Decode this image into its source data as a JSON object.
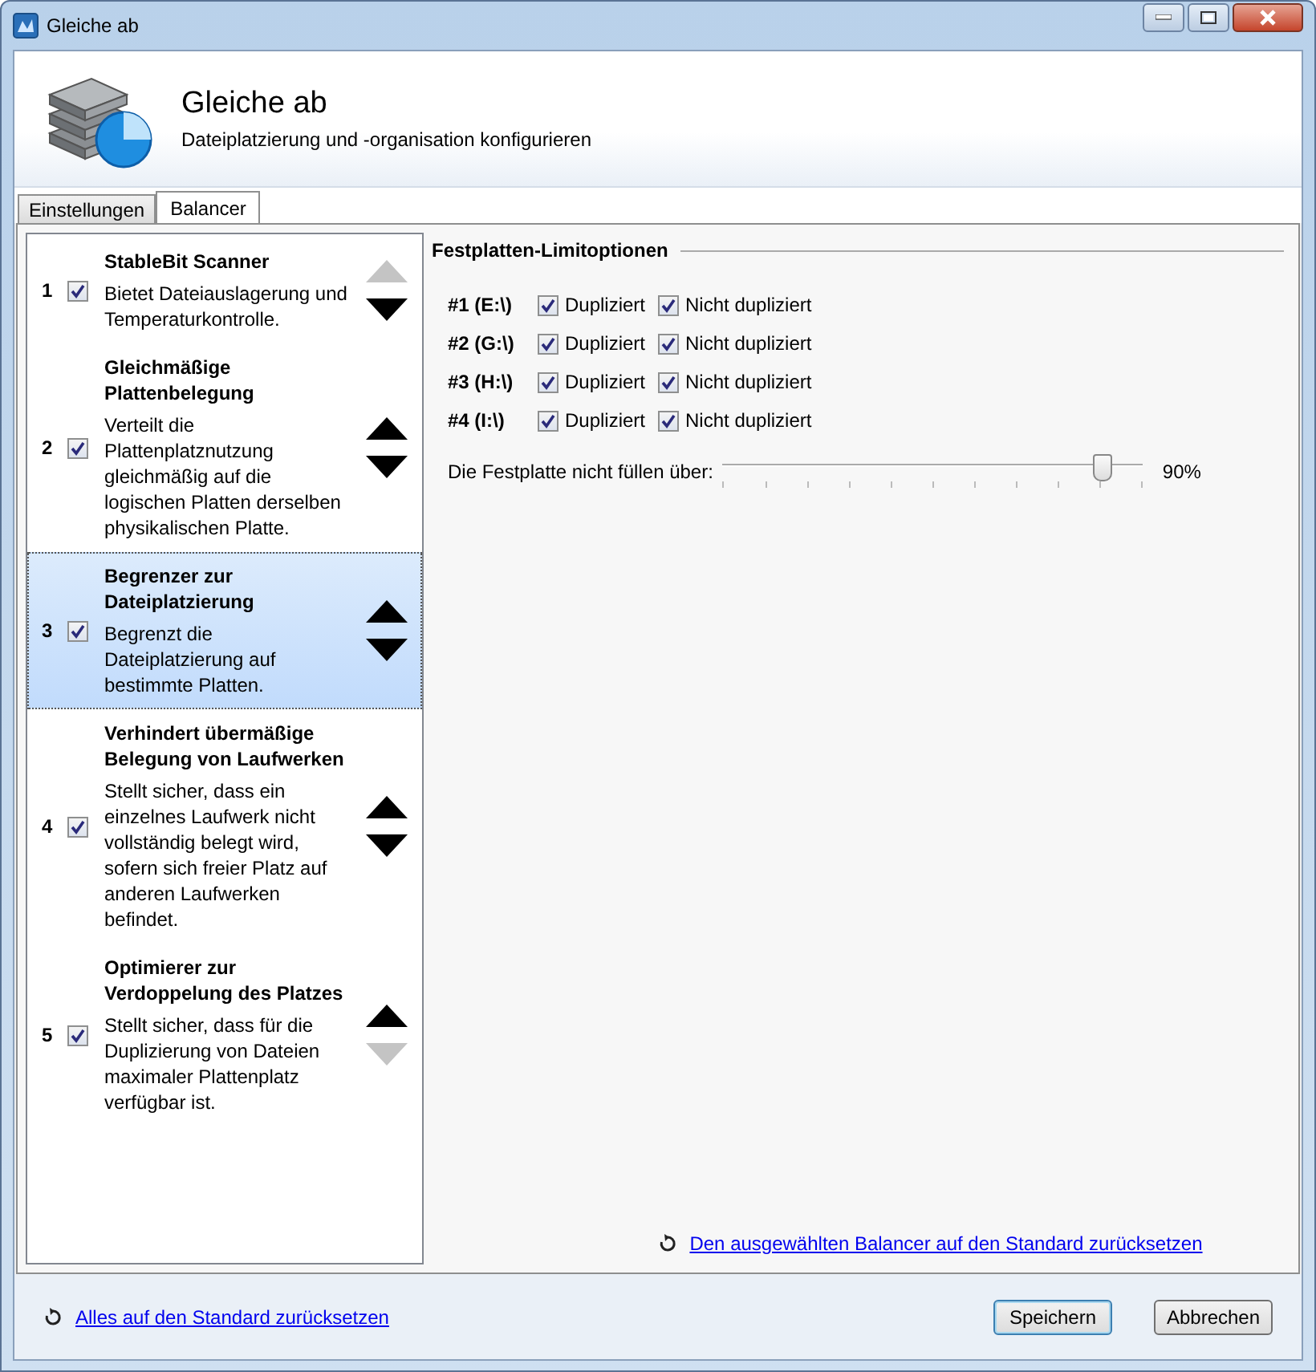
{
  "window": {
    "title": "Gleiche ab"
  },
  "header": {
    "title": "Gleiche ab",
    "subtitle": "Dateiplatzierung und -organisation konfigurieren"
  },
  "tabs": [
    {
      "label": "Einstellungen",
      "selected": false
    },
    {
      "label": "Balancer",
      "selected": true
    }
  ],
  "balancers": [
    {
      "number": "1",
      "checked": true,
      "title": "StableBit Scanner",
      "description": "Bietet Dateiauslagerung und Temperaturkontrolle.",
      "selected": false,
      "up_enabled": false,
      "down_enabled": true
    },
    {
      "number": "2",
      "checked": true,
      "title": "Gleichmäßige Plattenbelegung",
      "description": "Verteilt die Plattenplatznutzung gleichmäßig auf die logischen Platten derselben physikalischen Platte.",
      "selected": false,
      "up_enabled": true,
      "down_enabled": true
    },
    {
      "number": "3",
      "checked": true,
      "title": "Begrenzer zur Dateiplatzierung",
      "description": "Begrenzt die Dateiplatzierung auf bestimmte Platten.",
      "selected": true,
      "up_enabled": true,
      "down_enabled": true
    },
    {
      "number": "4",
      "checked": true,
      "title": "Verhindert übermäßige Belegung von Laufwerken",
      "description": "Stellt sicher, dass ein einzelnes Laufwerk nicht vollständig belegt wird, sofern sich freier Platz auf anderen Laufwerken befindet.",
      "selected": false,
      "up_enabled": true,
      "down_enabled": true
    },
    {
      "number": "5",
      "checked": true,
      "title": "Optimierer zur Verdoppelung des Platzes",
      "description": "Stellt sicher, dass für die Duplizierung von Dateien maximaler Plattenplatz verfügbar ist.",
      "selected": false,
      "up_enabled": true,
      "down_enabled": false
    }
  ],
  "options": {
    "title": "Festplatten-Limitoptionen",
    "drives": [
      {
        "label": "#1 (E:\\)",
        "duplicated": {
          "label": "Dupliziert",
          "checked": true
        },
        "unduplicated": {
          "label": "Nicht dupliziert",
          "checked": true
        }
      },
      {
        "label": "#2 (G:\\)",
        "duplicated": {
          "label": "Dupliziert",
          "checked": true
        },
        "unduplicated": {
          "label": "Nicht dupliziert",
          "checked": true
        }
      },
      {
        "label": "#3 (H:\\)",
        "duplicated": {
          "label": "Dupliziert",
          "checked": true
        },
        "unduplicated": {
          "label": "Nicht dupliziert",
          "checked": true
        }
      },
      {
        "label": "#4 (I:\\)",
        "duplicated": {
          "label": "Dupliziert",
          "checked": true
        },
        "unduplicated": {
          "label": "Nicht dupliziert",
          "checked": true
        }
      }
    ],
    "fill_limit": {
      "label": "Die Festplatte nicht füllen über:",
      "level": 0.9,
      "reading": "90%"
    },
    "reset_link": "Den ausgewählten Balancer auf den Standard zurücksetzen"
  },
  "footer": {
    "reset_all_link": "Alles auf den Standard zurücksetzen",
    "buttons": [
      {
        "label": "Speichern",
        "kind": "default"
      },
      {
        "label": "Abbrechen",
        "kind": "normal"
      }
    ]
  }
}
